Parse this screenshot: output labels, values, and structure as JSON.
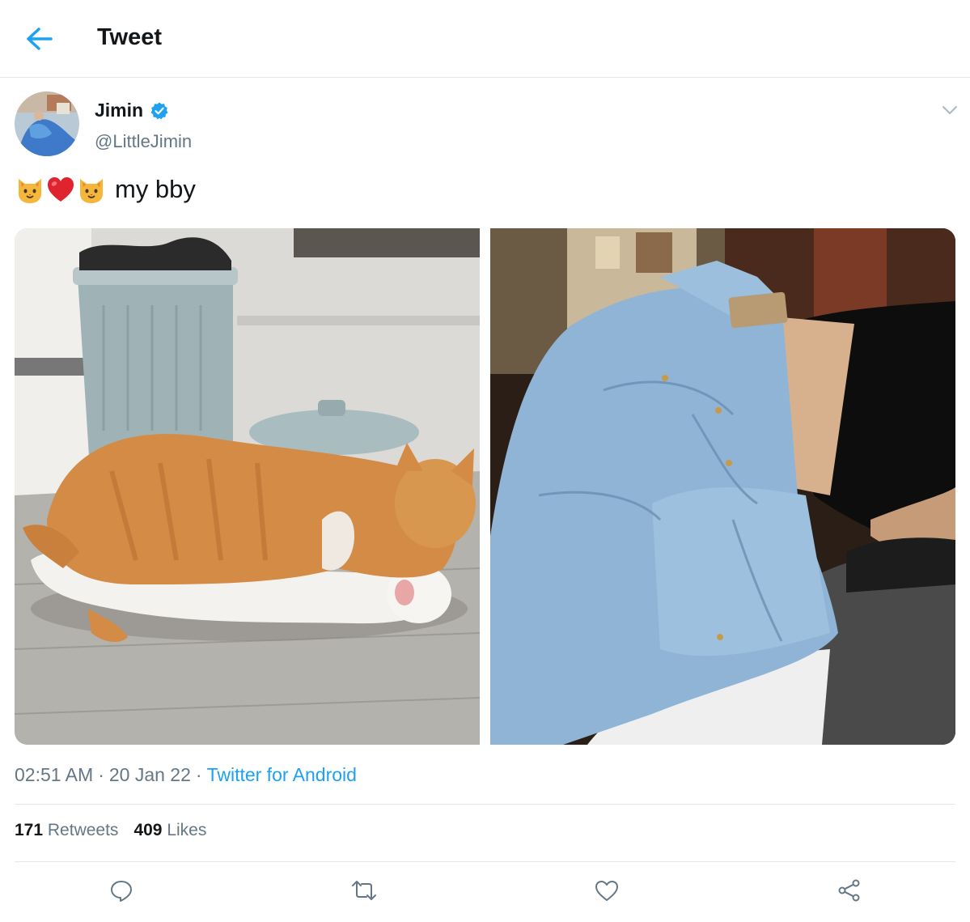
{
  "header": {
    "title": "Tweet",
    "back_icon": "arrow-left-icon",
    "accent": "#1da1f2"
  },
  "tweet": {
    "author_name": "Jimin",
    "author_handle": "@LittleJimin",
    "verified": true,
    "verified_icon": "verified-badge-icon",
    "text_emojis": [
      "cat-face-emoji",
      "red-heart-emoji",
      "cat-face-emoji"
    ],
    "text": "my bby",
    "time": "02:51 AM",
    "date": "20 Jan 22",
    "separator": "·",
    "source": "Twitter for Android",
    "media": [
      "cat-photo",
      "jeans-photo"
    ]
  },
  "stats": {
    "retweets_count": "171",
    "retweets_label": "Retweets",
    "likes_count": "409",
    "likes_label": "Likes"
  },
  "actions": [
    "reply-icon",
    "retweet-icon",
    "like-icon",
    "share-icon"
  ],
  "colors": {
    "text_primary": "#14171a",
    "text_secondary": "#657786",
    "divider": "#e1e8ed",
    "link": "#1da1f2"
  }
}
